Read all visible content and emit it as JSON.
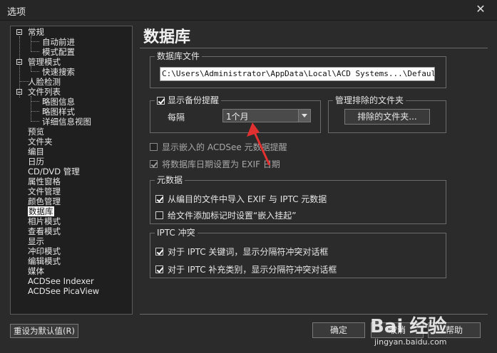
{
  "window": {
    "title": "选项"
  },
  "tree": {
    "items": [
      {
        "label": "常规"
      },
      {
        "label": "自动前进"
      },
      {
        "label": "模式配置"
      },
      {
        "label": "管理模式"
      },
      {
        "label": "快速搜索"
      },
      {
        "label": "人脸检测"
      },
      {
        "label": "文件列表"
      },
      {
        "label": "略图信息"
      },
      {
        "label": "略图样式"
      },
      {
        "label": "详细信息视图"
      },
      {
        "label": "预览"
      },
      {
        "label": "文件夹"
      },
      {
        "label": "编目"
      },
      {
        "label": "日历"
      },
      {
        "label": "CD/DVD 管理"
      },
      {
        "label": "属性窗格"
      },
      {
        "label": "文件管理"
      },
      {
        "label": "颜色管理"
      },
      {
        "label": "数据库"
      },
      {
        "label": "相片模式"
      },
      {
        "label": "查看模式"
      },
      {
        "label": "显示"
      },
      {
        "label": "冲印模式"
      },
      {
        "label": "编辑模式"
      },
      {
        "label": "媒体"
      },
      {
        "label": "ACDSee Indexer"
      },
      {
        "label": "ACDSee PicaView"
      }
    ],
    "selected": "数据库"
  },
  "page": {
    "title": "数据库"
  },
  "db_file": {
    "legend": "数据库文件",
    "path": "C:\\Users\\Administrator\\AppData\\Local\\ACD Systems...\\Default.dbin"
  },
  "backup": {
    "label": "显示备份提醒",
    "checked": true,
    "interval_label": "每隔",
    "interval_value": "1个月"
  },
  "excluded": {
    "legend": "管理排除的文件夹",
    "button": "排除的文件夹..."
  },
  "options": {
    "embedded_label": "显示嵌入的 ACDSee 元数据提醒",
    "exif_label": "将数据库日期设置为 EXIF 日期"
  },
  "metadata": {
    "legend": "元数据",
    "import_label": "从编目的文件中导入 EXIF 与 IPTC 元数据",
    "embed_label": "给文件添加标记时设置“嵌入挂起”"
  },
  "iptc": {
    "legend": "IPTC 冲突",
    "keywords_label": "对于 IPTC 关键词，显示分隔符冲突对话框",
    "categories_label": "对于 IPTC 补充类别，显示分隔符冲突对话框"
  },
  "buttons": {
    "reset": "重设为默认值(R)",
    "ok": "确定",
    "cancel": "取消",
    "help": "帮助"
  },
  "watermark": {
    "logo": "Bai 经验",
    "url": "jingyan.baidu.com"
  },
  "colors": {
    "background": "#2b2b2b",
    "selection": "#ffffff",
    "annotation_arrow": "#e03030"
  }
}
